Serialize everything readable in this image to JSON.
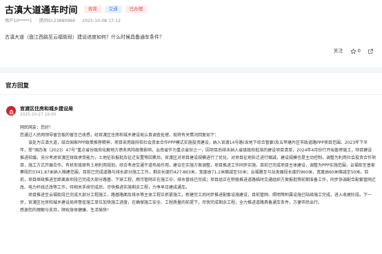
{
  "header": {
    "title": "古滇大道通车时间",
    "tags": [
      "咨询",
      "交通",
      "已办理"
    ],
    "user": "用户10*****1",
    "question_id": "提问ID:23880966",
    "timestamp": "2025-10-08 17:12"
  },
  "question": "古滇大道（盘江西路至云福街段）建设进度如何？什么时候具备通车条件？",
  "actions": {
    "follow_label": "关注",
    "like_count": "0",
    "like_icon": "star-icon",
    "share_icon": "share-icon"
  },
  "reply_section": {
    "title": "官方回复",
    "org_name": "官渡区住房和城乡建设局",
    "date": "2025-10-27 19:00",
    "accent_color": "#c8262c",
    "body": [
      "网民网友：您好！",
      "您通过人民网领导留言板的留言已收悉，经官渡区住房和城乡建设局认真调查处理，现将有关情况回复如下：",
      "该处为古滇大道，结合国家PPP政策推荐精神，项目采用政府和社会资本合作PPP模式实施投资建设，纳入官渡14号路(含地下综合管廊)及五甲塘片区市政道路PPP项目范围。2023年下半年，受“国办发〔2023〕47号”重点省份政府化解地方债务风险政策影响，云南省作为重点省份之一，因项目后续未纳入省级政府批准的建设项目清单，2024年4月份行开始暂停施工，项目建设推进较缓。充分考虑官渡区财政承受能力，土地征拆报批及征迁安置等因素后，官渡区对项目建设规模进行了优化，对项目征地拆迁进行缩减，建设规模也是主动控制，调整为利用社会投资合作项目，施工方式开展合作。有机衔接原有土地利用规划，综合考虑交通干道布局作用，建议在实施方案调整，项目推进工作同步实施，目前已完成项目主体建设，调整为PPP实施范围，云福街至普家寨段约3341.87米纳入缩建范围，目前已完成道路与排水部分施工工作，剩余长度约427.863米，宽度由71.2米缩减至50米；云福路至与站发展段长度约960米，宽度由60米缩减至50米。目前，项目继续推进至距离家坝段已完成大部分路基、下穿工程，雨污管网正在施工中，排水管线已完成；项目组正在积极推进道路临时交通组织方案报批等前期准备工作，同步协调配合配套管网迁改、电力杆线迁改等工作，待相关手续完成后，尽快推进实施剩余工程，力争早日建成通车。",
      "项目推进至云福街段已完成大部分工程施工，路基路面及排水等主体工程正抓紧施工，新建完工后同步推进配套设施建设，目前管网、照明等附属设施已陆续施工完成，进入收尾阶段。下一步，官渡区住房和城乡建设局将督促施工单位加快施工进度，在确保施工安全、工程质量的前提下，尽快完成剩余工程，全力推进道路具备通车条件，方便市民出行。",
      "感谢您的理解与支持，顺祝身体健康、生活愉快！"
    ]
  }
}
